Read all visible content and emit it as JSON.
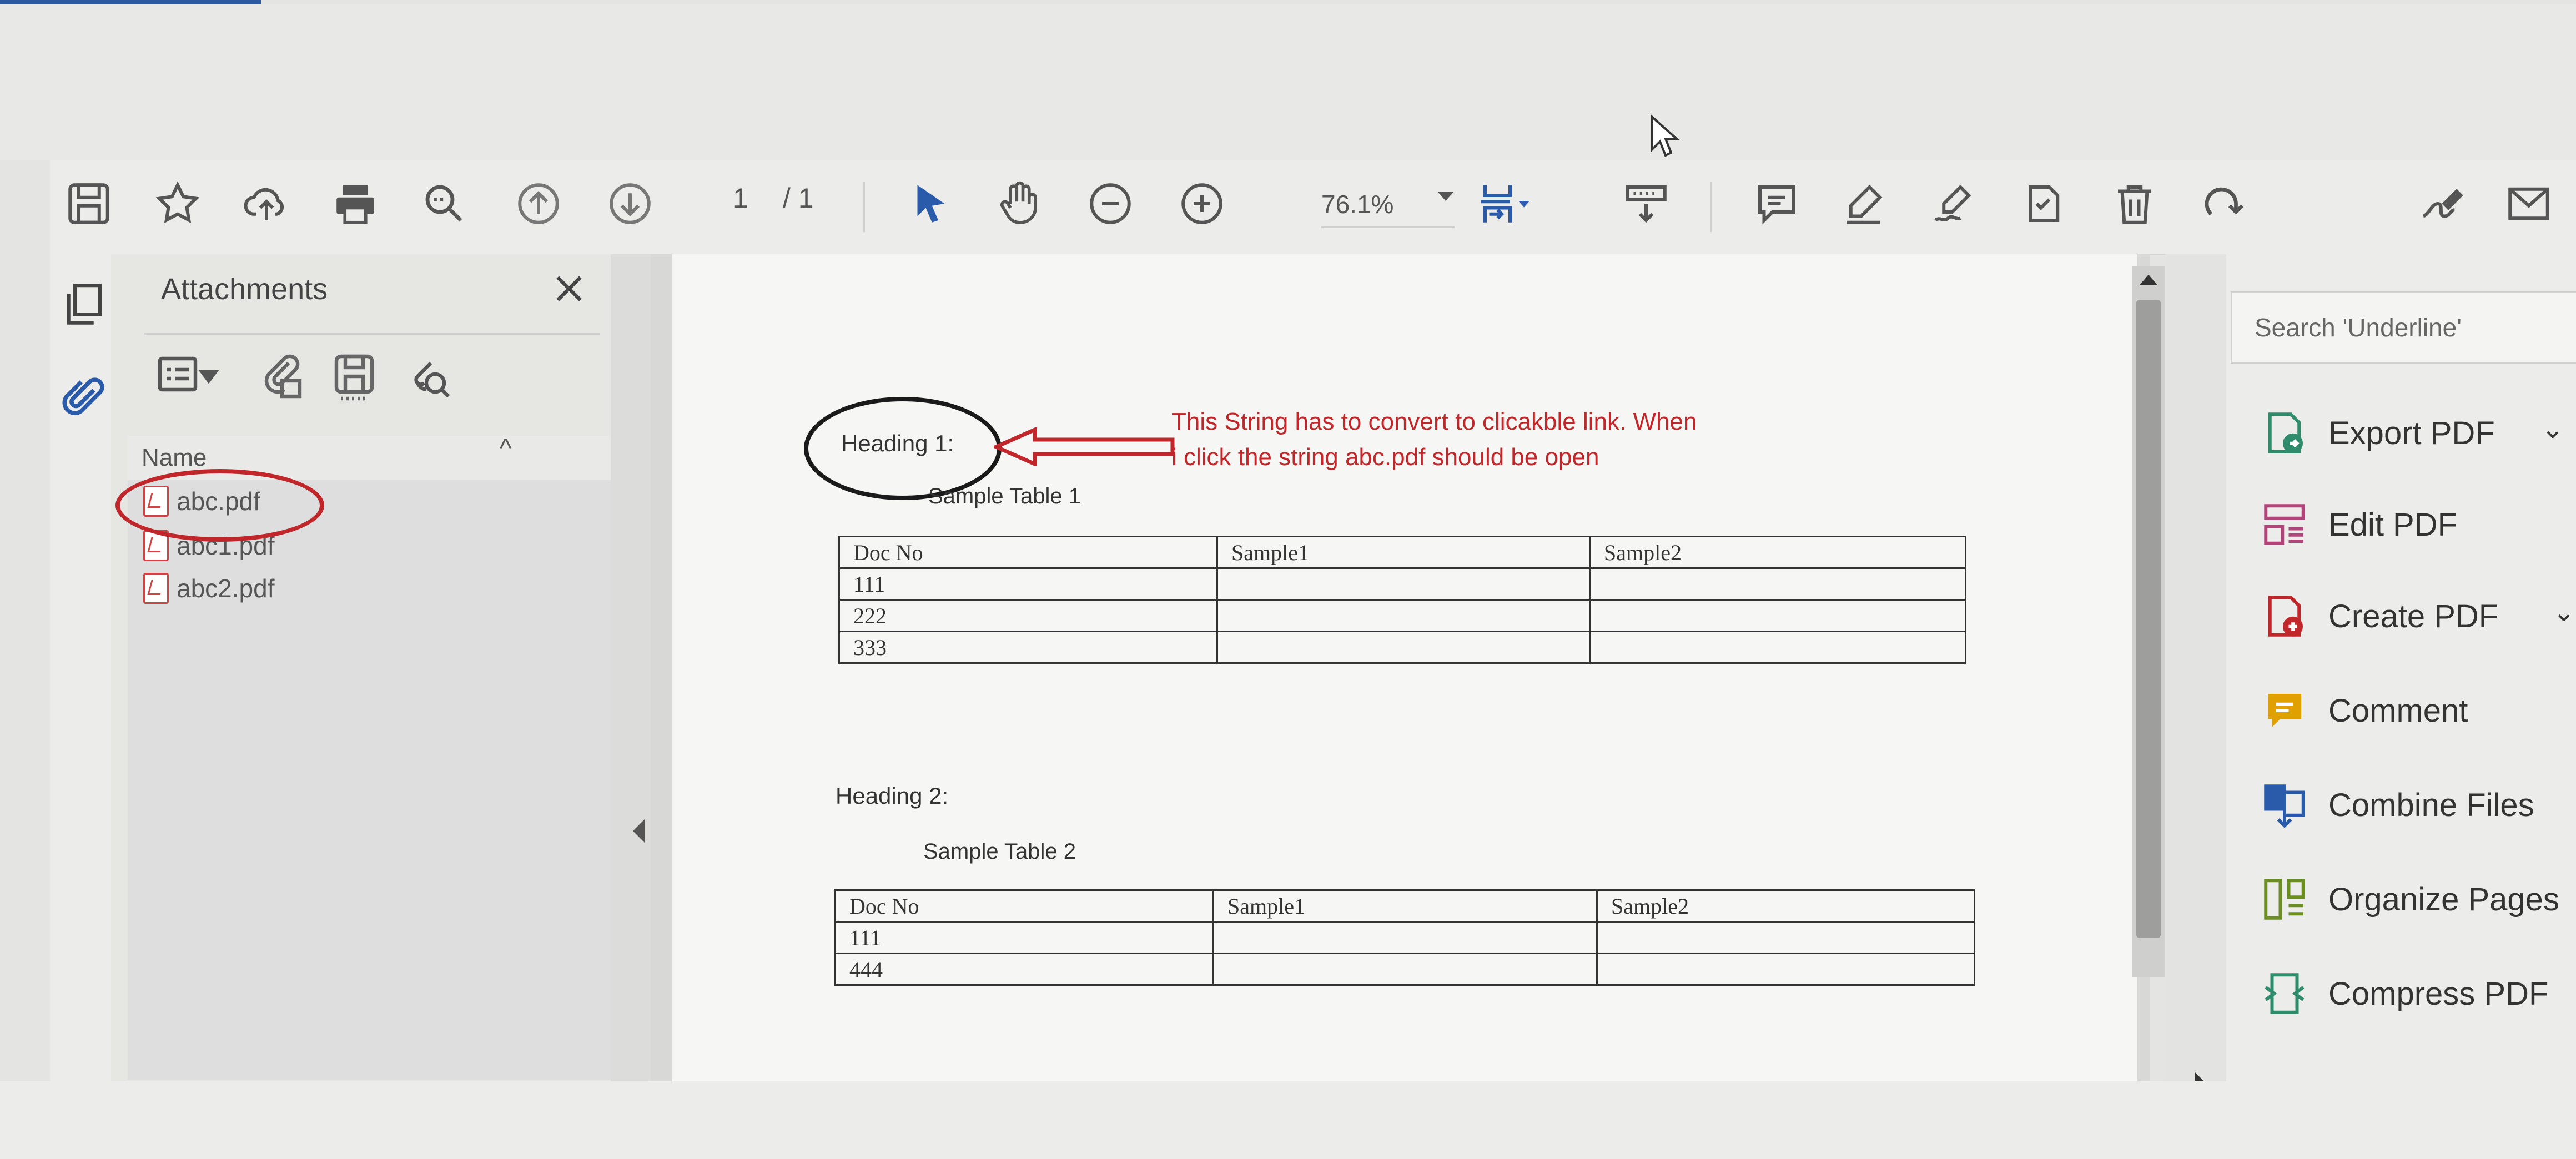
{
  "toolbar": {
    "page_current": "1",
    "page_total": "/ 1",
    "zoom": "76.1%"
  },
  "sidebar": {
    "title": "Attachments",
    "column_name": "Name",
    "files": [
      "abc.pdf",
      "abc1.pdf",
      "abc2.pdf"
    ]
  },
  "document": {
    "heading1": "Heading 1:",
    "table1_caption": "Sample Table 1",
    "annotation": "This String has to convert to clicakble link. When i click the string abc.pdf should be open",
    "table1": {
      "headers": [
        "Doc No",
        "Sample1",
        "Sample2"
      ],
      "rows": [
        [
          "111",
          "",
          ""
        ],
        [
          "222",
          "",
          ""
        ],
        [
          "333",
          "",
          ""
        ]
      ]
    },
    "heading2": "Heading 2:",
    "table2_caption": "Sample Table 2",
    "table2": {
      "headers": [
        "Doc No",
        "Sample1",
        "Sample2"
      ],
      "rows": [
        [
          "111",
          "",
          ""
        ],
        [
          "444",
          "",
          ""
        ]
      ]
    }
  },
  "right_panel": {
    "search_placeholder": "Search 'Underline'",
    "tools": [
      "Export PDF",
      "Edit PDF",
      "Create PDF",
      "Comment",
      "Combine Files",
      "Organize Pages",
      "Compress PDF"
    ]
  },
  "colors": {
    "annotation_red": "#c0262a",
    "accent_blue": "#2c5aa0"
  }
}
